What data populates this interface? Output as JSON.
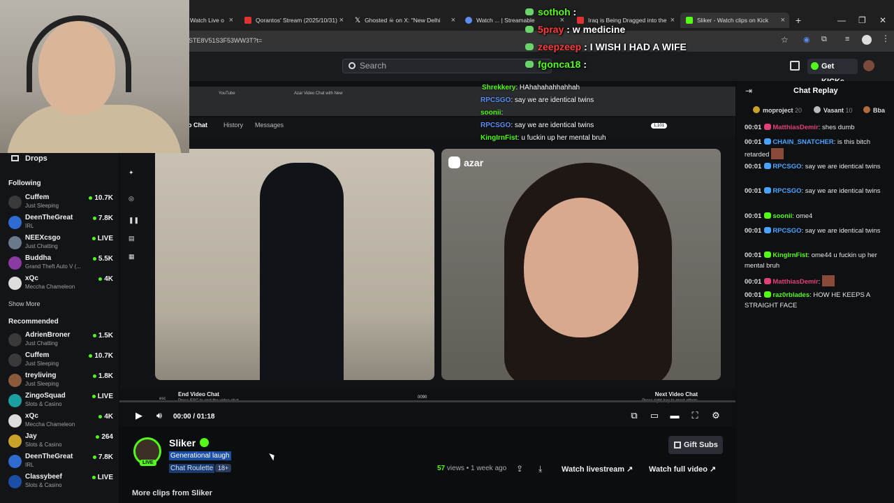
{
  "browser": {
    "tabs": [
      {
        "label": "Watch Live o",
        "color": "#d33"
      },
      {
        "label": "Qorantos' Stream (2025/10/31)",
        "color": "#d33"
      },
      {
        "label": "Ghosted ☠ on X: \"New Delhi",
        "color": "#fff"
      },
      {
        "label": "Watch ... | Streamable",
        "color": "#5b8def"
      },
      {
        "label": "Iraq is Being Dragged into the",
        "color": "#d33"
      },
      {
        "label": "Sliker - Watch clips on Kick",
        "color": "#53fc18"
      }
    ],
    "new_tab": "+",
    "url": "STE8V51S3F53WW3T?t=",
    "win_min": "—",
    "win_max": "❐",
    "win_close": "✕"
  },
  "kick_header": {
    "search_placeholder": "Search",
    "get_kicks": "Get KICKs"
  },
  "sidebar": {
    "drops": "Drops",
    "following_title": "Following",
    "following": [
      {
        "name": "Cuffem",
        "sub": "Just Sleeping",
        "viewers": "10.7K",
        "live": false,
        "dot": true
      },
      {
        "name": "DeenTheGreat",
        "sub": "IRL",
        "viewers": "7.8K",
        "live": false,
        "dot": true
      },
      {
        "name": "NEEXcsgo",
        "sub": "Just Chatting",
        "viewers": "LIVE",
        "live": true,
        "dot": true
      },
      {
        "name": "Buddha",
        "sub": "Grand Theft Auto V (...",
        "viewers": "5.5K",
        "live": false,
        "dot": true
      },
      {
        "name": "xQc",
        "sub": "Meccha Chameleon",
        "viewers": "4K",
        "live": false,
        "dot": true
      }
    ],
    "show_more": "Show More",
    "recommended_title": "Recommended",
    "recommended": [
      {
        "name": "AdrienBroner",
        "sub": "Just Chatting",
        "viewers": "1.5K",
        "dot": true
      },
      {
        "name": "Cuffem",
        "sub": "Just Sleeping",
        "viewers": "10.7K",
        "dot": true
      },
      {
        "name": "treyliving",
        "sub": "Just Sleeping",
        "viewers": "1.8K",
        "dot": true
      },
      {
        "name": "ZingoSquad",
        "sub": "Slots & Casino",
        "viewers": "LIVE",
        "dot": true
      },
      {
        "name": "xQc",
        "sub": "Meccha Chameleon",
        "viewers": "4K",
        "dot": true
      },
      {
        "name": "Jay",
        "sub": "Slots & Casino",
        "viewers": "264",
        "dot": true
      },
      {
        "name": "DeenTheGreat",
        "sub": "IRL",
        "viewers": "7.8K",
        "dot": true
      },
      {
        "name": "Classybeef",
        "sub": "Slots & Casino",
        "viewers": "LIVE",
        "dot": true
      }
    ]
  },
  "stream": {
    "inner_tabs": {
      "youtube": "YouTube",
      "azar": "Azar Video Chat with New"
    },
    "inner_nav": {
      "video_chat": "eo Chat",
      "history": "History",
      "messages": "Messages"
    },
    "azar": "azar",
    "end_video_chat": "End Video Chat",
    "end_hint": "Press ESC to end the video chat",
    "esc": "esc",
    "next_video_chat": "Next Video Chat",
    "next_hint": "Press right key to meet others",
    "counter": "0090",
    "gem_count": "1,101",
    "overlay_big": [
      {
        "user": "sothoh",
        "msg": ":",
        "color": "#53fc18"
      },
      {
        "user": "5pray",
        "msg": ": w medicine",
        "color": "#ff3b3b"
      },
      {
        "user": "zeepzeep",
        "msg": ": I WISH I HAD A WIFE",
        "color": "#ff3b3b"
      },
      {
        "user": "fgonca18",
        "msg": ":",
        "color": "#53fc18"
      }
    ],
    "overlay_small": [
      {
        "user": "Shrekkery",
        "msg": ": HAhahahahhahhah",
        "color": "#53fc18"
      },
      {
        "user": "RPCSGO",
        "msg": ": say we are identical twins",
        "color": "#5b8def"
      },
      {
        "user": "soonii",
        "msg": ":",
        "color": "#53fc18"
      },
      {
        "user": "RPCSGO",
        "msg": ": say we are identical twins",
        "color": "#5b8def"
      },
      {
        "user": "KingIrnFist",
        "msg": ": u fuckin up her mental bruh",
        "color": "#53fc18"
      }
    ]
  },
  "player": {
    "time_current": "00:00",
    "time_sep": "/",
    "time_total": "01:18"
  },
  "clip": {
    "streamer": "Sliker",
    "title": "Generational laugh",
    "category": "Chat Roulette",
    "age_badge": "18+",
    "live_badge": "LIVE",
    "views_count": "57",
    "views_label": "views",
    "time_ago": "• 1 week ago",
    "gift_subs": "Gift Subs",
    "watch_livestream": "Watch livestream",
    "watch_full": "Watch full video",
    "more_clips": "More clips from Sliker"
  },
  "chat": {
    "title": "Chat Replay",
    "leaderboard": [
      {
        "name": "moproject",
        "points": "20",
        "rank": "1"
      },
      {
        "name": "Vasant",
        "points": "10",
        "rank": "2"
      },
      {
        "name": "Bba",
        "points": "",
        "rank": "3"
      }
    ],
    "messages": [
      {
        "time": "00:01",
        "user": "MatthiasDemir",
        "color": "#e0407a",
        "text": ": shes dumb"
      },
      {
        "time": "00:01",
        "user": "CHAIN_SNATCHER",
        "color": "#4aa3ff",
        "text": ": is this bitch retarded"
      },
      {
        "time": "00:01",
        "user": "RPCSGO",
        "color": "#4aa3ff",
        "text": ": say we are identical twins"
      },
      {
        "time": "00:01",
        "user": "RPCSGO",
        "color": "#4aa3ff",
        "text": ": say we are identical twins"
      },
      {
        "time": "00:01",
        "user": "soonii",
        "color": "#53fc18",
        "text": ": ome4"
      },
      {
        "time": "00:01",
        "user": "RPCSGO",
        "color": "#4aa3ff",
        "text": ": say we are identical twins"
      },
      {
        "time": "00:01",
        "user": "KingIrnFist",
        "color": "#53fc18",
        "text": ": ome44 u fuckin up her mental bruh"
      },
      {
        "time": "00:01",
        "user": "MatthiasDemir",
        "color": "#e0407a",
        "text": ":"
      },
      {
        "time": "00:01",
        "user": "raz0rblades",
        "color": "#53fc18",
        "text": ": HOW HE KEEPS A STRAIGHT FACE"
      }
    ]
  }
}
